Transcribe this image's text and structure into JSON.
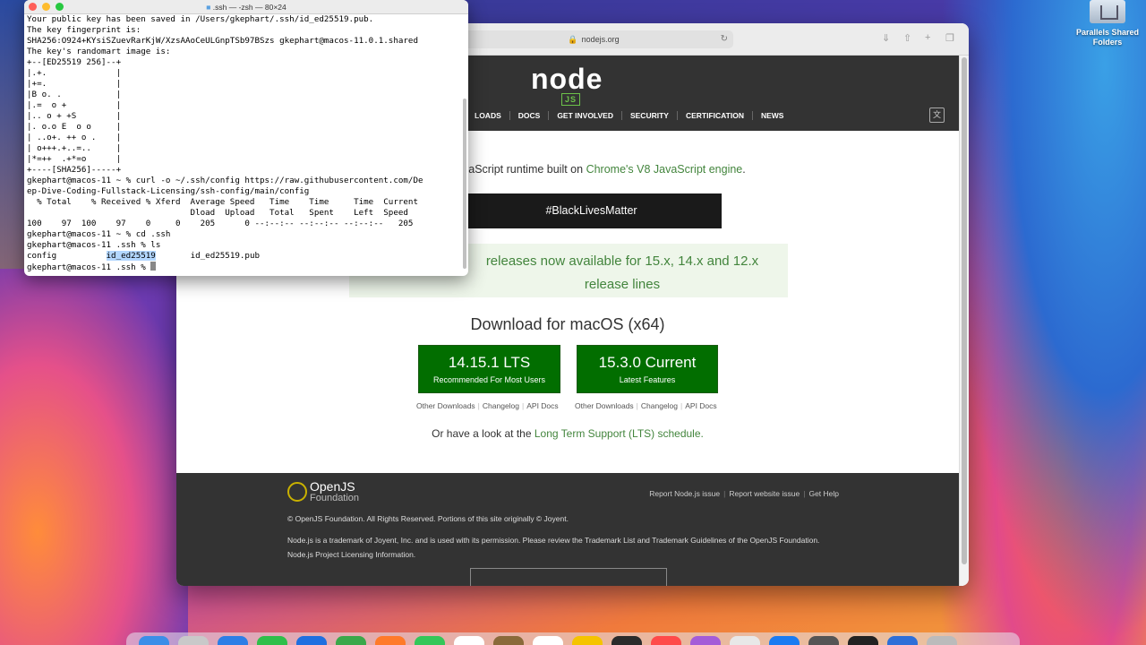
{
  "desktop": {
    "folder_label": "Parallels Shared Folders"
  },
  "terminal": {
    "title": ".ssh — -zsh — 80×24",
    "lines_before": [
      "Your public key has been saved in /Users/gkephart/.ssh/id_ed25519.pub.",
      "The key fingerprint is:",
      "SHA256:O924+KYsiSZuevRarKjW/XzsAAoCeULGnpTSb97BSzs gkephart@macos-11.0.1.shared",
      "The key's randomart image is:",
      "+--[ED25519 256]--+",
      "|.+.              |",
      "|+=.              |",
      "|B o. .           |",
      "|.=  o +          |",
      "|.. o + +S        |",
      "|. o.o E  o o     |",
      "| ..o+. ++ o .    |",
      "| o+++.+..=..     |",
      "|*=++  .+*=o      |",
      "+----[SHA256]-----+",
      "gkephart@macos-11 ~ % curl -o ~/.ssh/config https://raw.githubusercontent.com/De",
      "ep-Dive-Coding-Fullstack-Licensing/ssh-config/main/config",
      "  % Total    % Received % Xferd  Average Speed   Time    Time     Time  Current",
      "                                 Dload  Upload   Total   Spent    Left  Speed",
      "100    97  100    97    0     0    205      0 --:--:-- --:--:-- --:--:--   205",
      "gkephart@macos-11 ~ % cd .ssh",
      "gkephart@macos-11 .ssh % ls"
    ],
    "ls_config": "config          ",
    "ls_selected": "id_ed25519",
    "ls_pub": "       id_ed25519.pub",
    "prompt": "gkephart@macos-11 .ssh % "
  },
  "browser": {
    "url": "nodejs.org",
    "logo": "node",
    "logo_js": "JS",
    "nav": [
      "LOADS",
      "DOCS",
      "GET INVOLVED",
      "SECURITY",
      "CERTIFICATION",
      "NEWS"
    ],
    "tagline_prefix": "vaScript runtime built on ",
    "tagline_link": "Chrome's V8 JavaScript engine",
    "tagline_suffix": ".",
    "blm": "#BlackLivesMatter",
    "banner_line1": "releases now available for 15.x, 14.x and 12.x",
    "banner_line2": "release lines",
    "download_title": "Download for macOS (x64)",
    "lts": {
      "version": "14.15.1 LTS",
      "sub": "Recommended For Most Users"
    },
    "current": {
      "version": "15.3.0 Current",
      "sub": "Latest Features"
    },
    "sublinks": [
      "Other Downloads",
      "Changelog",
      "API Docs"
    ],
    "lts_prefix": "Or have a look at the ",
    "lts_link": "Long Term Support (LTS) schedule.",
    "footer": {
      "brand1": "OpenJS",
      "brand2": "Foundation",
      "links": [
        "Report Node.js issue",
        "Report website issue",
        "Get Help"
      ],
      "copyright": "© OpenJS Foundation. All Rights Reserved. Portions of this site originally © Joyent.",
      "trademark_prefix": "Node.js is a trademark of Joyent, Inc. and is used with its permission. Please review the ",
      "trademark_list": "Trademark List",
      "trademark_and": " and ",
      "trademark_guidelines": "Trademark Guidelines",
      "trademark_of": " of the ",
      "trademark_org": "OpenJS Foundation",
      "trademark_end": ".",
      "licensing": "Node.js Project Licensing Information."
    }
  },
  "dock": {
    "colors": [
      "#3b8ee8",
      "#c9c9c9",
      "#2d7ee6",
      "#2fbf4a",
      "#1f6fe0",
      "#3aa84a",
      "#ff7a2a",
      "#34c759",
      "#ffffff",
      "#8a6a3a",
      "#ffffff",
      "#f5c400",
      "#2b2b2b",
      "#ff4a4a",
      "#a45cd8",
      "#e8e8e8",
      "#1a7bf2",
      "#555555",
      "#222222",
      "#2e6fd8",
      "#bbbbbb"
    ]
  }
}
